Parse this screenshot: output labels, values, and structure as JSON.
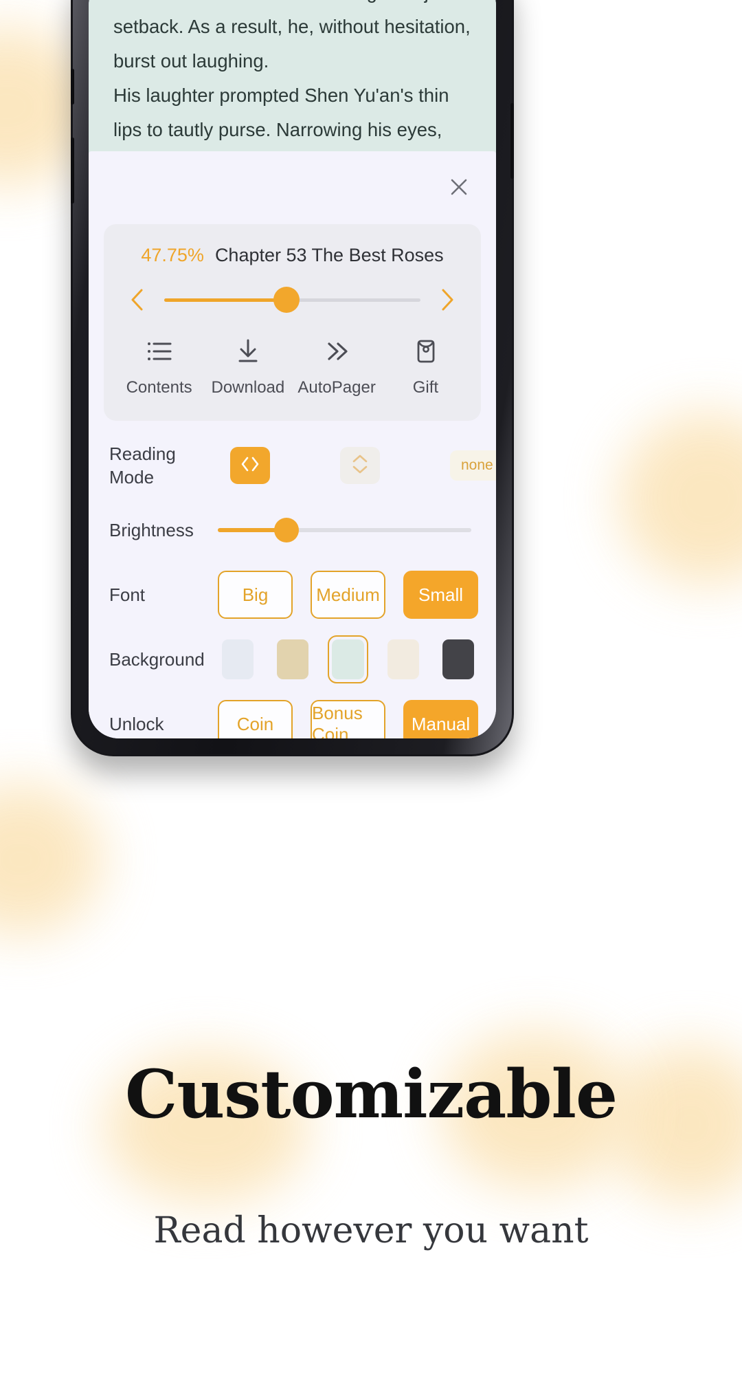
{
  "reader": {
    "paragraphs": [
      "heard Shen Yu'an encountering a major setback. As a result, he, without hesitation, burst out laughing.",
      "His laughter prompted Shen Yu'an's thin lips to tautly purse. Narrowing his eyes,"
    ],
    "background_color": "#dceae6"
  },
  "panel": {
    "close_icon": "close-icon",
    "chapter": {
      "progress_percent": "47.75%",
      "progress_value": 47.75,
      "title": "Chapter 53 The Best Roses",
      "prev_icon": "chevron-left-icon",
      "next_icon": "chevron-right-icon",
      "accent_color": "#efa52a"
    },
    "tools": [
      {
        "icon": "list-icon",
        "label": "Contents"
      },
      {
        "icon": "download-icon",
        "label": "Download"
      },
      {
        "icon": "double-chevron-right-icon",
        "label": "AutoPager"
      },
      {
        "icon": "gift-envelope-icon",
        "label": "Gift"
      }
    ],
    "reading_mode": {
      "label": "Reading Mode",
      "horizontal": {
        "icon": "horizontal-page-turn-icon",
        "selected": true
      },
      "vertical": {
        "icon": "vertical-scroll-icon",
        "selected": false
      },
      "none_label": "none"
    },
    "brightness": {
      "label": "Brightness",
      "value": 27
    },
    "font": {
      "label": "Font",
      "options": [
        {
          "label": "Big",
          "selected": false
        },
        {
          "label": "Medium",
          "selected": false
        },
        {
          "label": "Small",
          "selected": true
        }
      ]
    },
    "background": {
      "label": "Background",
      "swatches": [
        {
          "color": "#e6eaf2",
          "selected": false
        },
        {
          "color": "#e2d3ae",
          "selected": false
        },
        {
          "color": "#dbeae5",
          "selected": true
        },
        {
          "color": "#f2ebe0",
          "selected": false
        },
        {
          "color": "#434348",
          "selected": false
        }
      ]
    },
    "unlock": {
      "label": "Unlock",
      "options": [
        {
          "label": "Coin",
          "selected": false
        },
        {
          "label": "Bonus Coin",
          "selected": false
        },
        {
          "label": "Manual",
          "selected": true
        }
      ]
    }
  },
  "marketing": {
    "headline": "Customizable",
    "subhead": "Read however you want"
  }
}
